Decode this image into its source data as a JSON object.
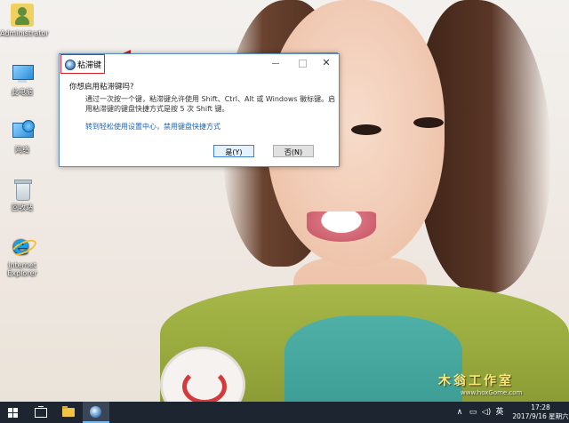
{
  "desktop": {
    "icons": [
      {
        "label": "Administrator",
        "icon": "user-folder-icon"
      },
      {
        "label": "此电脑",
        "icon": "computer-icon"
      },
      {
        "label": "网络",
        "icon": "network-icon"
      },
      {
        "label": "回收站",
        "icon": "recycle-bin-icon"
      },
      {
        "label": "Internet Explorer",
        "icon": "internet-explorer-icon"
      }
    ]
  },
  "dialog": {
    "title": "粘滞键",
    "question": "你想启用粘滞键吗?",
    "body": "通过一次按一个键，粘滞键允许使用 Shift、Ctrl、Alt 或 Windows 徽标键。启用粘滞键的键盘快捷方式是按 5 次 Shift 键。",
    "link": "转到轻松使用设置中心，禁用键盘快捷方式",
    "yes_label": "是(Y)",
    "no_label": "否(N)"
  },
  "watermark": {
    "text": "木翁工作室",
    "url": "www.hoxGome.com"
  },
  "taskbar": {
    "tray": {
      "ime": "英"
    },
    "clock": {
      "time": "17:28",
      "date": "2017/9/16 星期六"
    }
  },
  "colors": {
    "annotation": "#d81e1e",
    "taskbar": "#1c2530",
    "link": "#1a63b8"
  }
}
